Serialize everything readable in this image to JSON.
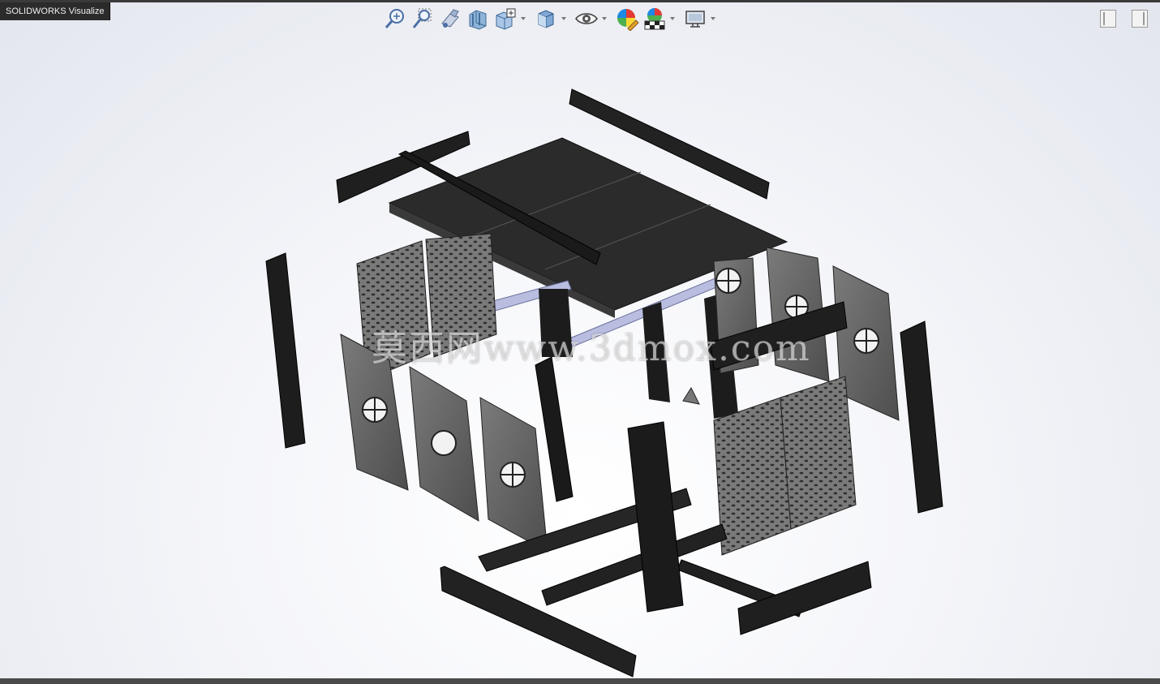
{
  "app": {
    "title": "SOLIDWORKS Visualize"
  },
  "toolbar": {
    "items": [
      {
        "icon": "zoom-to-fit-icon",
        "dropdown": false
      },
      {
        "icon": "zoom-to-area-icon",
        "dropdown": false
      },
      {
        "icon": "previous-view-icon",
        "dropdown": false
      },
      {
        "icon": "section-view-icon",
        "dropdown": false
      },
      {
        "icon": "view-orientation-icon",
        "dropdown": true
      },
      {
        "icon": "display-style-icon",
        "dropdown": true
      },
      {
        "icon": "hide-show-items-icon",
        "dropdown": true
      },
      {
        "icon": "edit-appearance-icon",
        "dropdown": false
      },
      {
        "icon": "apply-scene-icon",
        "dropdown": true
      },
      {
        "icon": "view-settings-icon",
        "dropdown": true
      }
    ]
  },
  "watermark": {
    "text": "莫西网www.3dmox.com"
  },
  "colors": {
    "part_dark": "#1e1e1e",
    "panel_gray": "#6f6f6f",
    "rail_blue": "#b9bde0",
    "background": "#eef0f5"
  }
}
